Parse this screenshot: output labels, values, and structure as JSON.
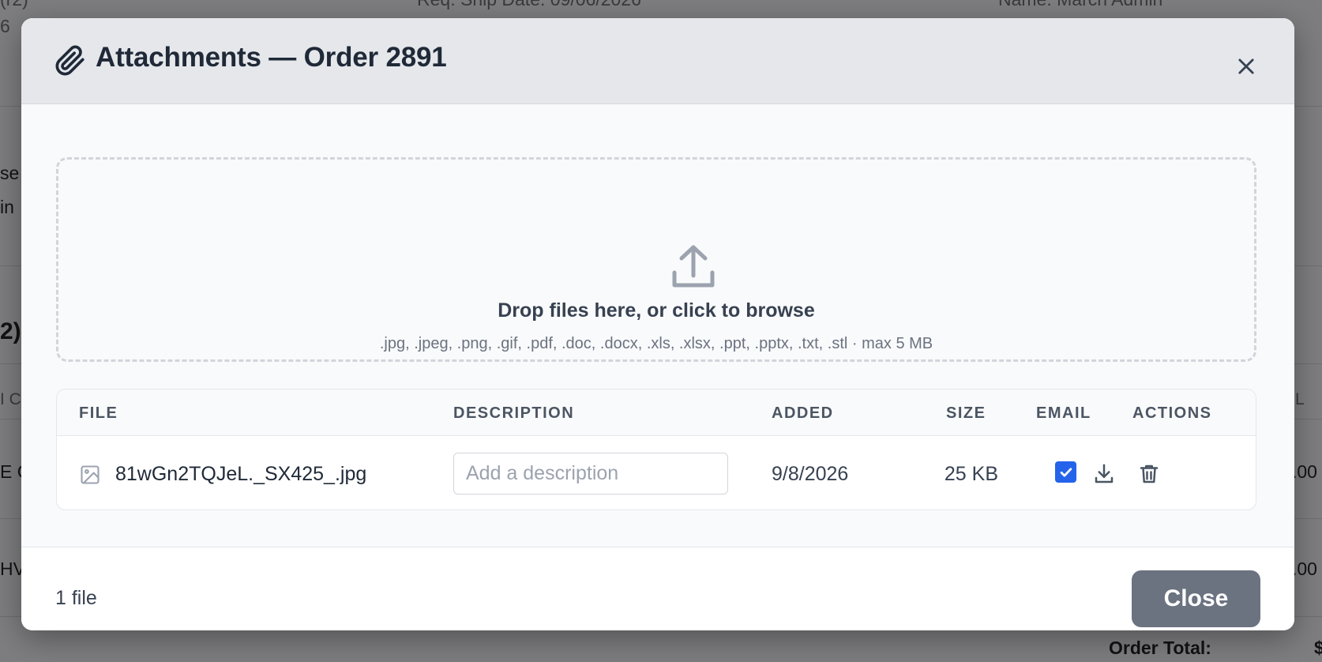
{
  "background": {
    "frag_1": "(r2)",
    "frag_2": "6",
    "frag_3": "Req. Ship Date: 09/06/2026",
    "frag_4": "Name: March Admin",
    "frag_5": "se",
    "frag_6": "in",
    "frag_7": "2)",
    "frag_8": "I C",
    "frag_9": "L",
    "frag_10": "E C",
    "frag_11": ".00",
    "frag_12": "HV",
    "frag_13": ".00",
    "order_total_label": "Order Total:",
    "frag_14": "$"
  },
  "modal": {
    "title": "Attachments — Order 2891",
    "header_icon": "paperclip-icon",
    "close_icon": "close-icon",
    "dropzone": {
      "icon": "upload-icon",
      "title": "Drop files here, or click to browse",
      "subtitle": ".jpg, .jpeg, .png, .gif, .pdf, .doc, .docx, .xls, .xlsx, .ppt, .pptx, .txt, .stl · max 5 MB"
    },
    "table": {
      "headers": {
        "file": "FILE",
        "description": "DESCRIPTION",
        "added": "ADDED",
        "size": "SIZE",
        "email": "EMAIL",
        "actions": "ACTIONS"
      },
      "rows": [
        {
          "file_icon": "image-icon",
          "file_name": "81wGn2TQJeL._SX425_.jpg",
          "description_value": "",
          "description_placeholder": "Add a description",
          "added": "9/8/2026",
          "size": "25 KB",
          "email_checked": true,
          "actions": [
            "download-icon",
            "trash-icon"
          ]
        }
      ]
    },
    "footer": {
      "file_count": "1 file",
      "close_label": "Close"
    },
    "colors": {
      "header_bg": "#e5e7eb",
      "checkbox": "#2563eb",
      "close_button": "#6b7280"
    }
  }
}
